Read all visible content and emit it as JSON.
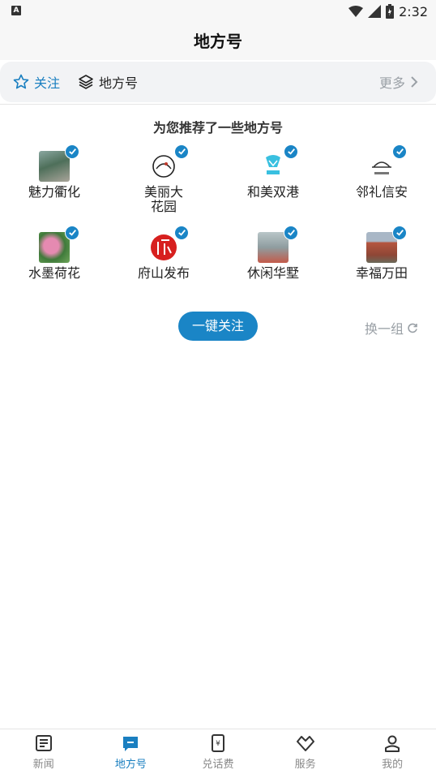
{
  "status": {
    "time": "2:32",
    "notif_letter": "A"
  },
  "header": {
    "title": "地方号"
  },
  "tabs": [
    {
      "label": "关注",
      "icon": "star-icon",
      "active": true
    },
    {
      "label": "地方号",
      "icon": "layers-icon",
      "active": false
    }
  ],
  "more_label": "更多",
  "recommend": {
    "title": "为您推荐了一些地方号",
    "items": [
      {
        "name": "魅力衢化",
        "checked": true
      },
      {
        "name": "美丽大花园",
        "checked": true
      },
      {
        "name": "和美双港",
        "checked": true
      },
      {
        "name": "邻礼信安",
        "checked": true
      },
      {
        "name": "水墨荷花",
        "checked": true
      },
      {
        "name": "府山发布",
        "checked": true
      },
      {
        "name": "休闲华墅",
        "checked": true
      },
      {
        "name": "幸福万田",
        "checked": true
      }
    ],
    "follow_all_label": "一键关注",
    "swap_label": "换一组"
  },
  "nav": [
    {
      "label": "新闻",
      "icon": "news-icon",
      "active": false
    },
    {
      "label": "地方号",
      "icon": "local-icon",
      "active": true
    },
    {
      "label": "兑话费",
      "icon": "phone-icon",
      "active": false
    },
    {
      "label": "服务",
      "icon": "service-icon",
      "active": false
    },
    {
      "label": "我的",
      "icon": "user-icon",
      "active": false
    }
  ],
  "colors": {
    "accent": "#1a85c6",
    "muted": "#9aa0a6",
    "text": "#222222"
  }
}
